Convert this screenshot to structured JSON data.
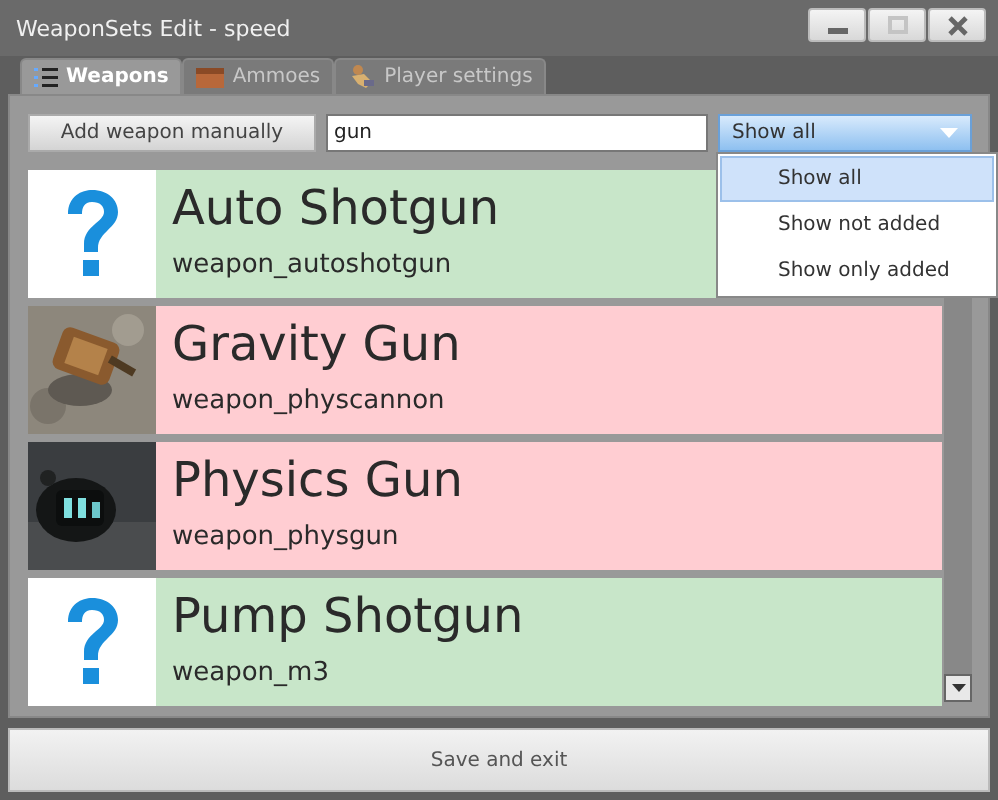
{
  "window": {
    "title": "WeaponSets Edit - speed",
    "controls": [
      {
        "kind": "minimize",
        "disabled": false
      },
      {
        "kind": "maximize",
        "disabled": true
      },
      {
        "kind": "close",
        "disabled": false
      }
    ]
  },
  "tabs": [
    {
      "label": "Weapons",
      "kind": "list",
      "selected": true
    },
    {
      "label": "Ammoes",
      "kind": "box",
      "selected": false
    },
    {
      "label": "Player settings",
      "kind": "figure",
      "selected": false
    }
  ],
  "toolbar": {
    "add_button": "Add weapon manually",
    "search": {
      "value": "gun"
    },
    "filter": {
      "value": "Show all",
      "expanded": true,
      "options": [
        {
          "label": "Show all",
          "selected": true
        },
        {
          "label": "Show not added",
          "selected": false
        },
        {
          "label": "Show only added",
          "selected": false
        }
      ]
    }
  },
  "weapons": [
    {
      "name": "Auto Shotgun",
      "class": "weapon_autoshotgun",
      "added": true,
      "kind": "question"
    },
    {
      "name": "Gravity Gun",
      "class": "weapon_physcannon",
      "added": false,
      "kind": "picture"
    },
    {
      "name": "Physics Gun",
      "class": "weapon_physgun",
      "added": false,
      "kind": "picture"
    },
    {
      "name": "Pump Shotgun",
      "class": "weapon_m3",
      "added": true,
      "kind": "question"
    }
  ],
  "save_button": "Save and exit"
}
